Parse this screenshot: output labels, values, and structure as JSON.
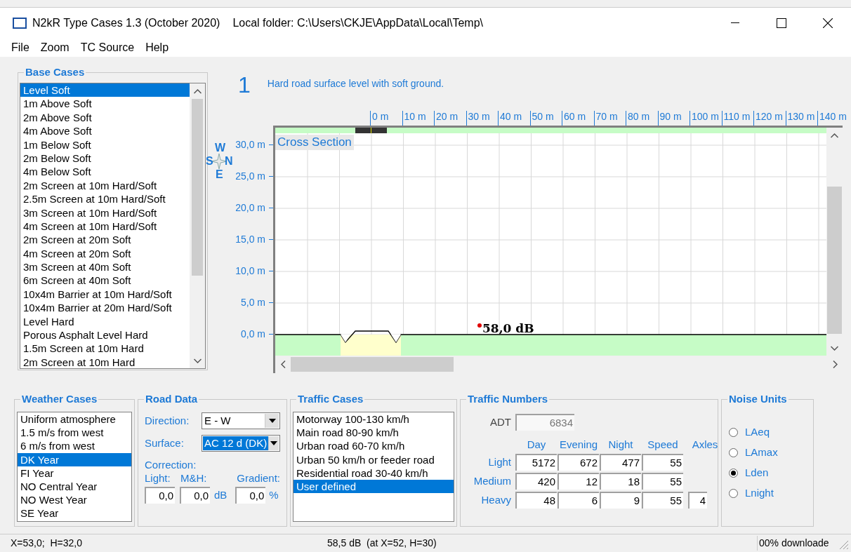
{
  "window": {
    "title": "N2kR Type Cases 1.3 (October 2020)",
    "folder": "Local folder: C:\\Users\\CKJE\\AppData\\Local\\Temp\\"
  },
  "menu": [
    "File",
    "Zoom",
    "TC Source",
    "Help"
  ],
  "base_cases": {
    "title": "Base Cases",
    "items": [
      {
        "label": "Level Soft",
        "selected": true
      },
      {
        "label": "1m Above Soft",
        "selected": false
      },
      {
        "label": "2m Above Soft",
        "selected": false
      },
      {
        "label": "4m Above Soft",
        "selected": false
      },
      {
        "label": "1m Below Soft",
        "selected": false
      },
      {
        "label": "2m Below Soft",
        "selected": false
      },
      {
        "label": "4m Below Soft",
        "selected": false
      },
      {
        "label": "2m Screen at 10m Hard/Soft",
        "selected": false
      },
      {
        "label": "2.5m Screen at 10m Hard/Soft",
        "selected": false
      },
      {
        "label": "3m Screen at 10m Hard/Soft",
        "selected": false
      },
      {
        "label": "4m Screen at 10m Hard/Soft",
        "selected": false
      },
      {
        "label": "2m Screen at 20m Soft",
        "selected": false
      },
      {
        "label": "4m Screen at 20m Soft",
        "selected": false
      },
      {
        "label": "3m Screen at 40m Soft",
        "selected": false
      },
      {
        "label": "6m Screen at 40m Soft",
        "selected": false
      },
      {
        "label": "10x4m Barrier at 10m Hard/Soft",
        "selected": false
      },
      {
        "label": "10x4m Barrier at 20m Hard/Soft",
        "selected": false
      },
      {
        "label": "Level Hard",
        "selected": false
      },
      {
        "label": "Porous Asphalt Level Hard",
        "selected": false
      },
      {
        "label": "1.5m Screen at 10m Hard",
        "selected": false
      },
      {
        "label": "2m Screen at 10m Hard",
        "selected": false
      }
    ]
  },
  "case": {
    "number": "1",
    "description": "Hard road surface level with soft ground."
  },
  "cross_section": {
    "title": "Cross Section",
    "x_ticks": [
      "0 m",
      "10 m",
      "20 m",
      "30 m",
      "40 m",
      "50 m",
      "60 m",
      "70 m",
      "80 m",
      "90 m",
      "100 m",
      "110 m",
      "120 m",
      "130 m",
      "140 m"
    ],
    "y_ticks": [
      "30,0 m",
      "25,0 m",
      "20,0 m",
      "15,0 m",
      "10,0 m",
      "5,0 m",
      "0,0 m"
    ],
    "receiver_label": "58,0 dB",
    "compass": {
      "west": "W",
      "south": "S",
      "north": "N",
      "east": "E"
    }
  },
  "weather_cases": {
    "title": "Weather Cases",
    "items": [
      {
        "label": "Uniform atmosphere",
        "selected": false
      },
      {
        "label": "1.5 m/s from west",
        "selected": false
      },
      {
        "label": "6 m/s from west",
        "selected": false
      },
      {
        "label": "DK Year",
        "selected": true
      },
      {
        "label": "FI Year",
        "selected": false
      },
      {
        "label": "NO Central Year",
        "selected": false
      },
      {
        "label": "NO West Year",
        "selected": false
      },
      {
        "label": "SE Year",
        "selected": false
      }
    ]
  },
  "road_data": {
    "title": "Road Data",
    "direction": {
      "label": "Direction:",
      "value": "E - W",
      "highlighted": false
    },
    "surface": {
      "label": "Surface:",
      "value": "AC 12 d (DK)",
      "highlighted": true
    },
    "correction_label": "Correction:",
    "light_label": "Light:",
    "mh_label": "M&H:",
    "gradient_label": "Gradient:",
    "light": "0,0",
    "mh": "0,0",
    "db_unit": "dB",
    "gradient": "0,0",
    "percent_unit": "%"
  },
  "traffic_cases": {
    "title": "Traffic Cases",
    "items": [
      {
        "label": "Motorway 100-130 km/h",
        "selected": false
      },
      {
        "label": "Main road 80-90 km/h",
        "selected": false
      },
      {
        "label": "Urban road 60-70 km/h",
        "selected": false
      },
      {
        "label": "Urban 50 km/h or feeder road",
        "selected": false
      },
      {
        "label": "Residential road 30-40 km/h",
        "selected": false
      },
      {
        "label": "User defined",
        "selected": true
      }
    ]
  },
  "traffic_numbers": {
    "title": "Traffic Numbers",
    "adt_label": "ADT",
    "adt": "6834",
    "columns": [
      "Day",
      "Evening",
      "Night",
      "Speed",
      "Axles"
    ],
    "rows": [
      {
        "label": "Light",
        "values": [
          "5172",
          "672",
          "477",
          "55"
        ]
      },
      {
        "label": "Medium",
        "values": [
          "420",
          "12",
          "18",
          "55"
        ]
      },
      {
        "label": "Heavy",
        "values": [
          "48",
          "6",
          "9",
          "55",
          "4"
        ]
      }
    ]
  },
  "noise_units": {
    "title": "Noise Units",
    "items": [
      {
        "label": "LAeq",
        "selected": false
      },
      {
        "label": "LAmax",
        "selected": false
      },
      {
        "label": "Lden",
        "selected": true
      },
      {
        "label": "Lnight",
        "selected": false
      }
    ]
  },
  "status_bar": {
    "position": "X=53,0;  H=32,0",
    "level": "58,5 dB  (at X=52, H=30)",
    "download": "00% downloade"
  }
}
